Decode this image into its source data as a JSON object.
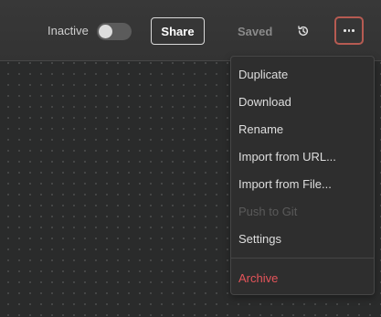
{
  "header": {
    "status_label": "Inactive",
    "toggle_state": "off",
    "share_label": "Share",
    "saved_label": "Saved",
    "history_icon": "history-icon",
    "more_icon": "ellipsis-icon",
    "accent_color": "#b65b52"
  },
  "menu": {
    "items": [
      {
        "label": "Duplicate",
        "enabled": true
      },
      {
        "label": "Download",
        "enabled": true
      },
      {
        "label": "Rename",
        "enabled": true
      },
      {
        "label": "Import from URL...",
        "enabled": true
      },
      {
        "label": "Import from File...",
        "enabled": true
      },
      {
        "label": "Push to Git",
        "enabled": false
      },
      {
        "label": "Settings",
        "enabled": true
      }
    ],
    "danger_item": {
      "label": "Archive",
      "color": "#e5545a"
    }
  }
}
